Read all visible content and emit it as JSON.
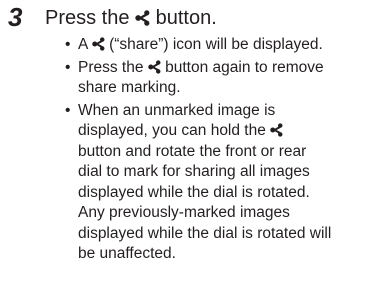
{
  "step": {
    "number": "3",
    "heading_before": "Press the",
    "heading_after": "button."
  },
  "icon_name": "share-icon",
  "bullet_marker": "•",
  "bullets": [
    {
      "lines": [
        {
          "before": "A",
          "after": "(“share”) icon will be displayed."
        }
      ]
    },
    {
      "lines": [
        {
          "before": "Press the",
          "after": "button again to remove"
        },
        {
          "text": "share marking."
        }
      ]
    },
    {
      "lines": [
        {
          "text": "When an unmarked image is"
        },
        {
          "before": "displayed, you can hold the",
          "after": ""
        },
        {
          "text": "button and rotate the front or rear"
        },
        {
          "text": "dial to mark for sharing all images"
        },
        {
          "text": "displayed while the dial is rotated."
        },
        {
          "text": "Any previously-marked images"
        },
        {
          "text": "displayed while the dial is rotated will"
        },
        {
          "text": "be unaffected."
        }
      ]
    }
  ]
}
